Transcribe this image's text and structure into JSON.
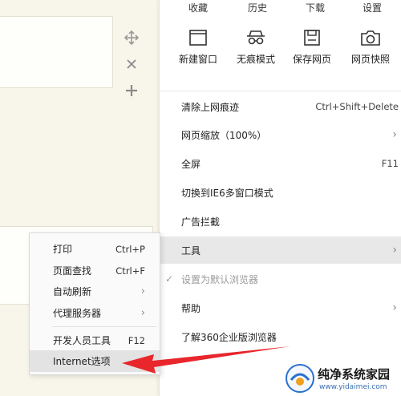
{
  "tabs": [
    "收藏",
    "历史",
    "下载",
    "设置"
  ],
  "side_tools": {
    "move_icon": "move-icon",
    "close_icon": "close-icon",
    "add_icon": "plus-icon"
  },
  "quick_actions": [
    {
      "label": "新建窗口",
      "icon": "new-window-icon"
    },
    {
      "label": "无痕模式",
      "icon": "incognito-icon"
    },
    {
      "label": "保存网页",
      "icon": "save-page-icon"
    },
    {
      "label": "网页快照",
      "icon": "snapshot-icon"
    }
  ],
  "menu": {
    "clear_traces": {
      "label": "清除上网痕迹",
      "shortcut": "Ctrl+Shift+Delete"
    },
    "zoom": {
      "label": "网页缩放（100%）",
      "arrow": "›"
    },
    "fullscreen": {
      "label": "全屏",
      "shortcut": "F11"
    },
    "ie6": {
      "label": "切换到IE6多窗口模式"
    },
    "adblock": {
      "label": "广告拦截"
    },
    "tools": {
      "label": "工具",
      "arrow": "›"
    },
    "default_browser": {
      "label": "设置为默认浏览器",
      "check": "✓"
    },
    "help": {
      "label": "帮助",
      "arrow": "›"
    },
    "about": {
      "label": "了解360企业版浏览器"
    }
  },
  "submenu": {
    "print": {
      "label": "打印",
      "shortcut": "Ctrl+P"
    },
    "find": {
      "label": "页面查找",
      "shortcut": "Ctrl+F"
    },
    "autorefresh": {
      "label": "自动刷新",
      "arrow": "›"
    },
    "proxy": {
      "label": "代理服务器",
      "arrow": "›"
    },
    "devtools": {
      "label": "开发人员工具",
      "shortcut": "F12"
    },
    "internet_options": {
      "label": "Internet选项"
    }
  },
  "watermark": {
    "title": "纯净系统家园",
    "url": "www.yidaimei.com"
  },
  "colors": {
    "highlight": "#e8e8e8",
    "arrow_red": "#e8262b",
    "watermark_blue": "#2a6fd0"
  }
}
